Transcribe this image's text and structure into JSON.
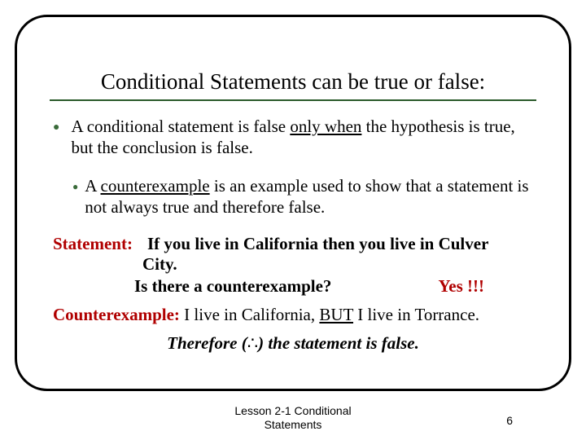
{
  "title": "Conditional Statements can be true or false:",
  "bullets": {
    "b1_pre": "A conditional statement is false ",
    "b1_uw": "only when",
    "b1_post": " the hypothesis is true, but the conclusion is false.",
    "b2_pre": "A ",
    "b2_uw": "counterexample",
    "b2_post": " is an example used to show that a statement is not always true and therefore false."
  },
  "statement": {
    "label": "Statement:",
    "line1": "If you live in California then you live in Culver",
    "line2": "City.",
    "question": "Is there a counterexample?",
    "answer": "Yes !!!"
  },
  "counter": {
    "label": "Counterexample:",
    "pre": " I live in California, ",
    "but": "BUT",
    "post": " I live in Torrance."
  },
  "therefore": {
    "pre": "Therefore (",
    "sym": "∴",
    "post": ") the statement is false."
  },
  "footer": {
    "line1": "Lesson 2-1 Conditional",
    "line2": "Statements",
    "page": "6"
  }
}
